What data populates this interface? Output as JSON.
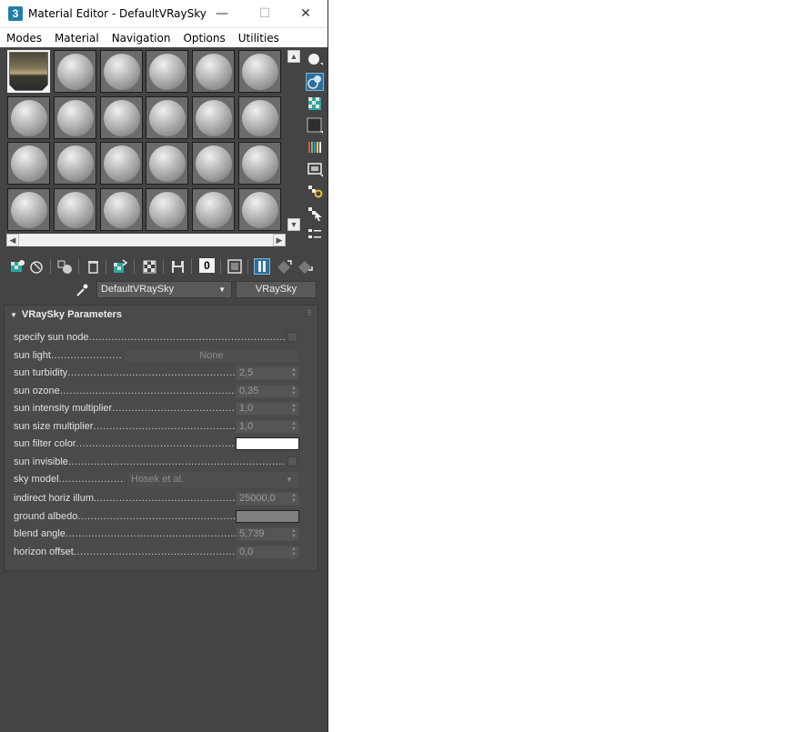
{
  "window": {
    "app_icon": "3",
    "title": "Material Editor - DefaultVRaySky",
    "controls": {
      "minimize": "—",
      "maximize": "☐",
      "close": "✕"
    }
  },
  "menu": [
    "Modes",
    "Material",
    "Navigation",
    "Options",
    "Utilities"
  ],
  "slots": {
    "rows": 4,
    "cols": 6,
    "active_index": 0,
    "active_material": "sky"
  },
  "side_toolbar_icons": [
    "sample-type-icon",
    "backlight-icon",
    "background-icon",
    "uv-tiling-icon",
    "video-color-check-icon",
    "make-preview-icon",
    "options-icon",
    "select-by-material-icon",
    "material-map-navigator-icon"
  ],
  "bottom_toolbar_icons": [
    "get-material-icon",
    "put-to-scene-icon",
    "assign-to-selection-icon",
    "reset-map-icon",
    "make-unique-icon",
    "put-to-library-icon",
    "material-id-channel-icon",
    "show-map-in-viewport-icon",
    "show-end-result-icon",
    "go-to-parent-icon",
    "go-forward-to-sibling-icon"
  ],
  "material_id_channel": "0",
  "material": {
    "name": "DefaultVRaySky",
    "type": "VRaySky"
  },
  "rollout": {
    "title": "VRaySky Parameters",
    "params": {
      "specify_sun_node": {
        "label": "specify sun node",
        "checked": false
      },
      "sun_light": {
        "label": "sun light",
        "value": "None"
      },
      "sun_turbidity": {
        "label": "sun turbidity",
        "value": "2,5"
      },
      "sun_ozone": {
        "label": "sun ozone",
        "value": "0,35"
      },
      "sun_intensity_multiplier": {
        "label": "sun intensity multiplier",
        "value": "1,0"
      },
      "sun_size_multiplier": {
        "label": "sun size multiplier",
        "value": "1,0"
      },
      "sun_filter_color": {
        "label": "sun filter color",
        "color": "#ffffff"
      },
      "sun_invisible": {
        "label": "sun invisible",
        "checked": false
      },
      "sky_model": {
        "label": "sky model",
        "value": "Hosek et al."
      },
      "indirect_horiz_illum": {
        "label": "indirect horiz illum.",
        "value": "25000,0"
      },
      "ground_albedo": {
        "label": "ground albedo",
        "color": "#808080"
      },
      "blend_angle": {
        "label": "blend angle",
        "value": "5,739"
      },
      "horizon_offset": {
        "label": "horizon offset",
        "value": "0,0"
      }
    }
  },
  "colors": {
    "accent": "#2e6e9e",
    "panel": "#444444"
  }
}
